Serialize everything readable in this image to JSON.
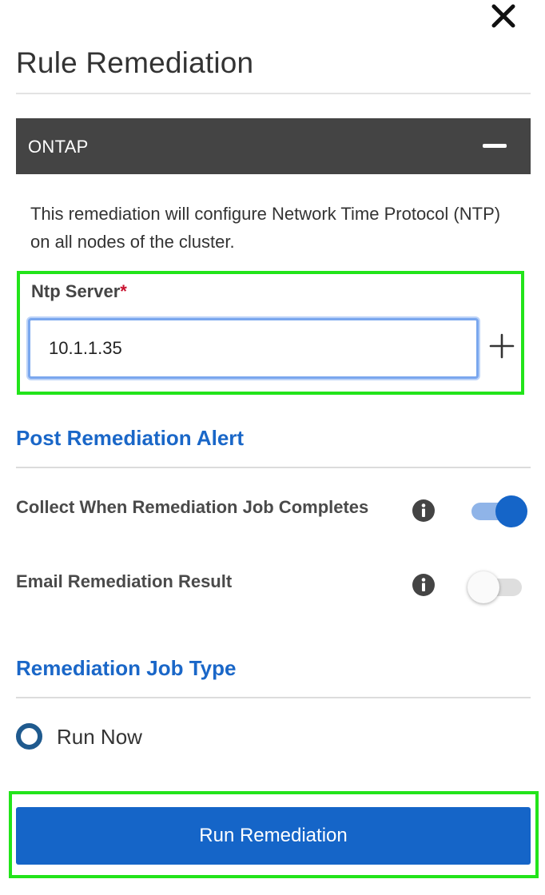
{
  "dialog": {
    "title": "Rule Remediation",
    "close_icon": "close-icon"
  },
  "section": {
    "name": "ONTAP",
    "toggle_icon": "minus-icon",
    "description": "This remediation will configure Network Time Protocol (NTP) on all nodes of the cluster."
  },
  "ntp_server": {
    "label": "Ntp Server",
    "required_mark": "*",
    "value": "10.1.1.35",
    "add_icon": "plus-icon"
  },
  "post_remediation_alert": {
    "heading": "Post Remediation Alert",
    "options": [
      {
        "label": "Collect When Remediation Job Completes",
        "enabled": true,
        "info_icon": "info-icon"
      },
      {
        "label": "Email Remediation Result",
        "enabled": false,
        "info_icon": "info-icon"
      }
    ]
  },
  "job_type": {
    "heading": "Remediation Job Type",
    "options": [
      {
        "label": "Run Now",
        "selected": true
      }
    ]
  },
  "actions": {
    "run_label": "Run Remediation"
  },
  "colors": {
    "accent": "#1565c8",
    "header_bg": "#444444",
    "highlight_border": "#22e41a",
    "required": "#c8102e",
    "radio": "#1f5a8e"
  }
}
